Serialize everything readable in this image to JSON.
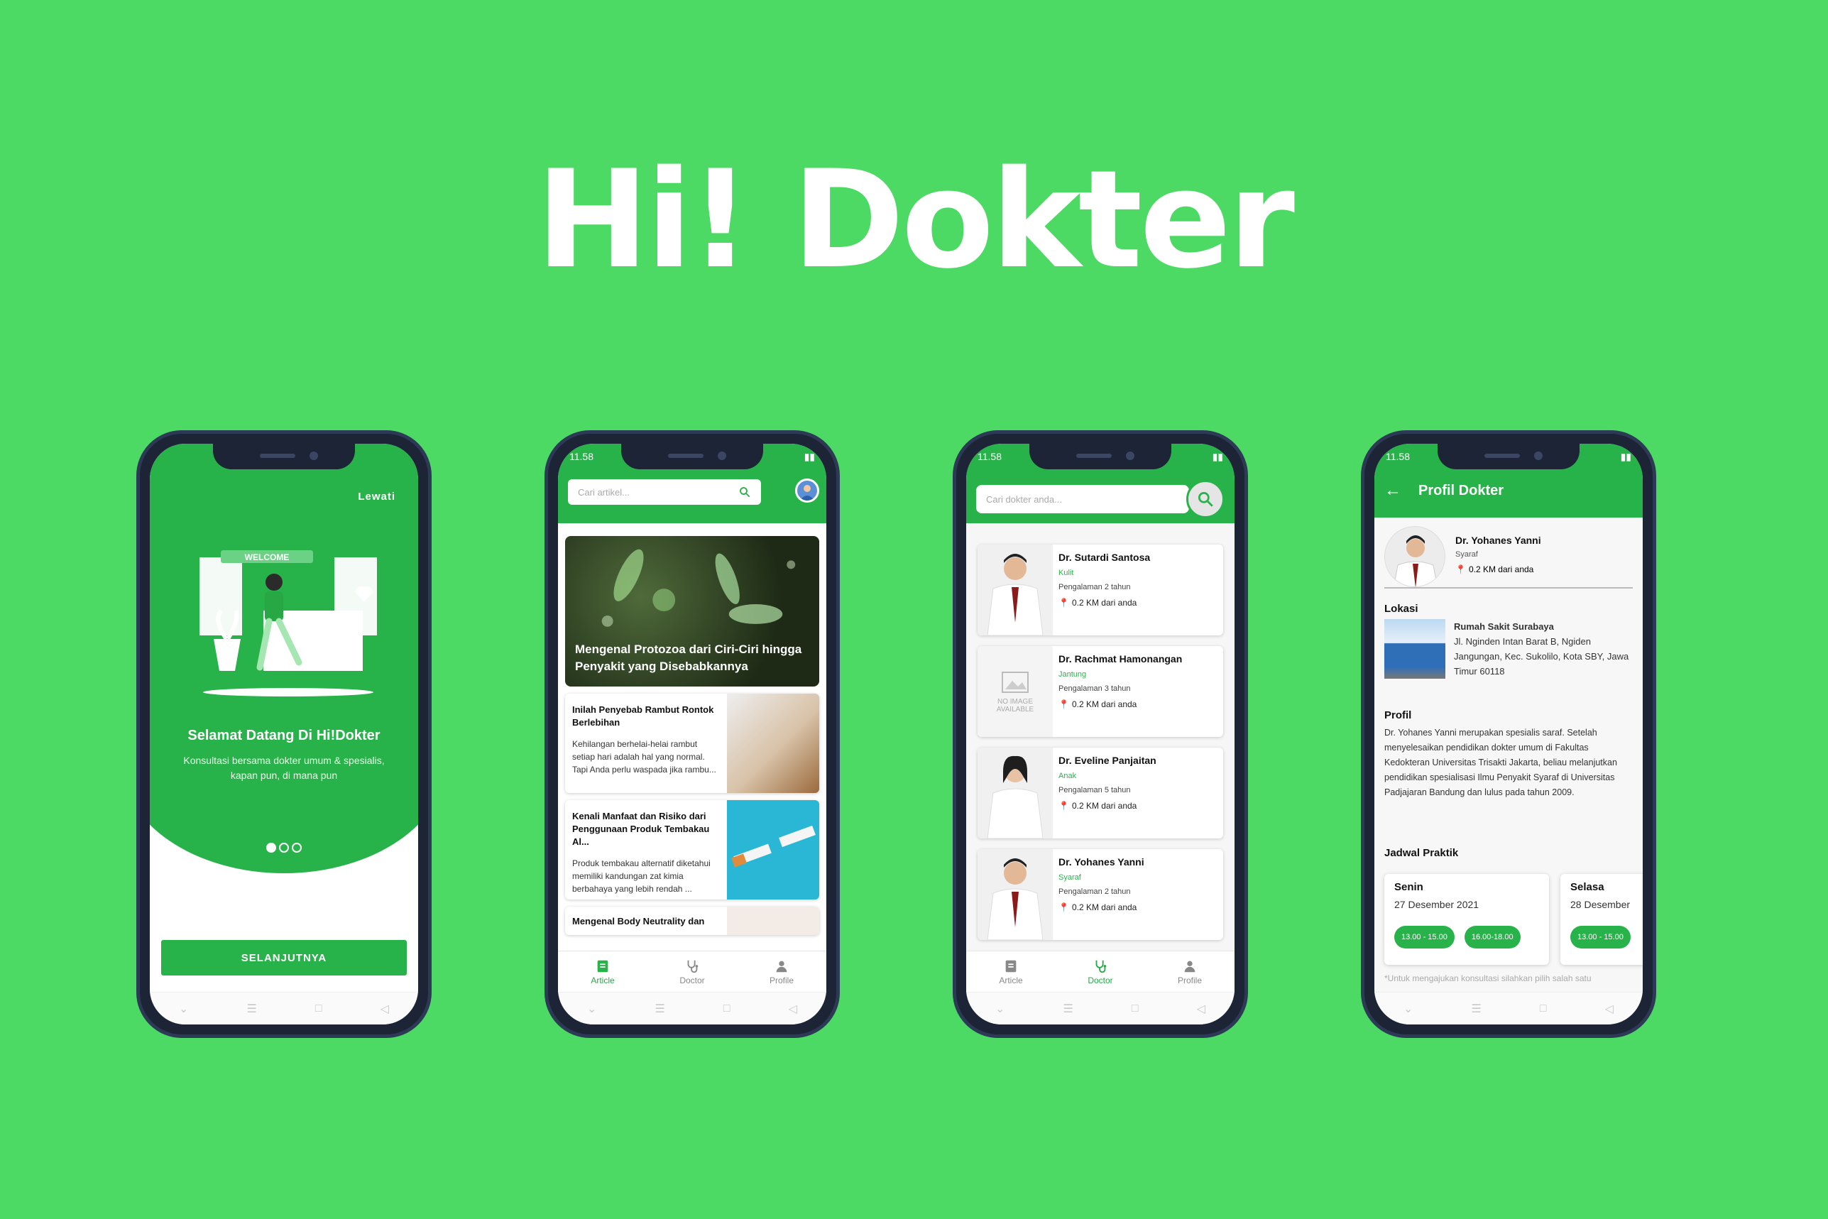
{
  "brand": {
    "title": "Hi! Dokter"
  },
  "colors": {
    "background": "#4cd964",
    "accent": "#28b34a"
  },
  "status_bar": {
    "time": "11.58"
  },
  "onboarding": {
    "skip_label": "Lewati",
    "illustration_text": "WELCOME",
    "title": "Selamat Datang Di Hi!Dokter",
    "subtitle": "Konsultasi bersama dokter umum & spesialis, kapan pun, di mana pun",
    "next_label": "SELANJUTNYA",
    "page_index": 1,
    "page_count": 3
  },
  "articles_screen": {
    "search_placeholder": "Cari artikel...",
    "hero_title": "Mengenal Protozoa dari Ciri-Ciri hingga Penyakit yang Disebabkannya",
    "articles": [
      {
        "title": "Inilah Penyebab Rambut Rontok Berlebihan",
        "excerpt": "Kehilangan berhelai-helai rambut setiap hari adalah hal yang normal. Tapi Anda perlu waspada jika rambu..."
      },
      {
        "title": "Kenali Manfaat dan Risiko dari Penggunaan Produk Tembakau Al...",
        "excerpt": "Produk tembakau alternatif diketahui memiliki kandungan zat kimia berbahaya yang lebih rendah ..."
      },
      {
        "title": "Mengenal Body Neutrality dan",
        "excerpt": ""
      }
    ]
  },
  "tabs": {
    "article": "Article",
    "doctor": "Doctor",
    "profile": "Profile"
  },
  "doctors_screen": {
    "search_placeholder": "Cari dokter anda...",
    "no_image": "NO IMAGE AVAILABLE",
    "doctors": [
      {
        "name": "Dr. Sutardi Santosa",
        "specialty": "Kulit",
        "experience": "Pengalaman 2 tahun",
        "distance": "0.2 KM dari anda"
      },
      {
        "name": "Dr. Rachmat Hamonangan",
        "specialty": "Jantung",
        "experience": "Pengalaman 3 tahun",
        "distance": "0.2 KM dari anda"
      },
      {
        "name": "Dr. Eveline Panjaitan",
        "specialty": "Anak",
        "experience": "Pengalaman 5 tahun",
        "distance": "0.2 KM dari anda"
      },
      {
        "name": "Dr. Yohanes Yanni",
        "specialty": "Syaraf",
        "experience": "Pengalaman 2 tahun",
        "distance": "0.2 KM dari anda"
      }
    ]
  },
  "profile_screen": {
    "title": "Profil Dokter",
    "name": "Dr. Yohanes Yanni",
    "specialty": "Syaraf",
    "distance": "0.2 KM dari anda",
    "location_heading": "Lokasi",
    "hospital": "Rumah Sakit Surabaya",
    "address": "Jl. Nginden Intan Barat B, Ngiden Jangungan, Kec. Sukolilo, Kota SBY, Jawa Timur 60118",
    "profile_heading": "Profil",
    "bio": "Dr. Yohanes Yanni merupakan spesialis saraf. Setelah menyelesaikan pendidikan dokter umum di Fakultas Kedokteran Universitas Trisakti Jakarta, beliau melanjutkan pendidikan spesialisasi Ilmu Penyakit Syaraf di Universitas Padjajaran Bandung dan lulus pada tahun 2009.",
    "schedule_heading": "Jadwal Praktik",
    "schedule": [
      {
        "day": "Senin",
        "date": "27 Desember 2021",
        "slots": [
          "13.00 - 15.00",
          "16.00-18.00"
        ]
      },
      {
        "day": "Selasa",
        "date": "28 Desember",
        "slots": [
          "13.00 - 15.00"
        ]
      }
    ],
    "note": "*Untuk mengajukan konsultasi silahkan pilih salah satu"
  }
}
